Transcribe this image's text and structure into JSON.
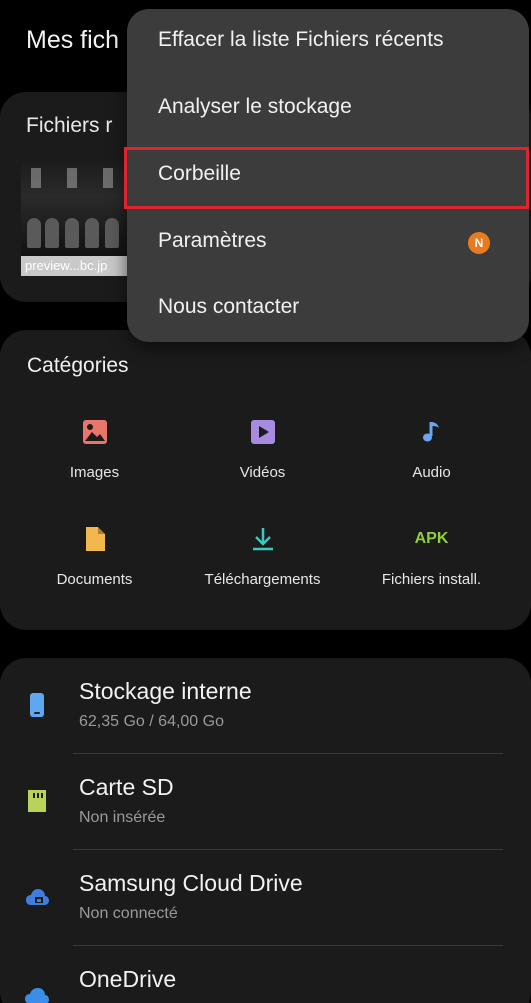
{
  "header": {
    "title": "Mes fich"
  },
  "recent": {
    "title": "Fichiers r",
    "files": [
      {
        "caption": "preview...bc.jp"
      }
    ]
  },
  "categories": {
    "title": "Catégories",
    "items": [
      {
        "label": "Images",
        "icon": "image-icon",
        "color": "#e8766a"
      },
      {
        "label": "Vidéos",
        "icon": "video-icon",
        "color": "#a78be0"
      },
      {
        "label": "Audio",
        "icon": "music-note-icon",
        "color": "#6aa6f0"
      },
      {
        "label": "Documents",
        "icon": "document-icon",
        "color": "#f2b84d"
      },
      {
        "label": "Téléchargements",
        "icon": "download-icon",
        "color": "#3ec6c2"
      },
      {
        "label": "Fichiers install.",
        "icon": "apk-icon",
        "icon_text": "APK",
        "color": "#8fcf3a"
      }
    ]
  },
  "storage": {
    "items": [
      {
        "name": "Stockage interne",
        "sub": "62,35 Go / 64,00 Go",
        "icon": "phone-storage-icon",
        "color": "#5fa8f0"
      },
      {
        "name": "Carte SD",
        "sub": "Non insérée",
        "icon": "sd-card-icon",
        "color": "#b8d25a"
      },
      {
        "name": "Samsung Cloud Drive",
        "sub": "Non connecté",
        "icon": "cloud-drive-icon",
        "color": "#3f7de0"
      },
      {
        "name": "OneDrive",
        "sub": "",
        "icon": "onedrive-icon",
        "color": "#3a8ee8"
      }
    ]
  },
  "menu": {
    "items": [
      {
        "label": "Effacer la liste Fichiers récents"
      },
      {
        "label": "Analyser le stockage"
      },
      {
        "label": "Corbeille",
        "highlighted": true
      },
      {
        "label": "Paramètres",
        "badge": "N"
      },
      {
        "label": "Nous contacter"
      }
    ],
    "highlight_color": "#e0242b",
    "badge_color": "#ea7a1e"
  }
}
